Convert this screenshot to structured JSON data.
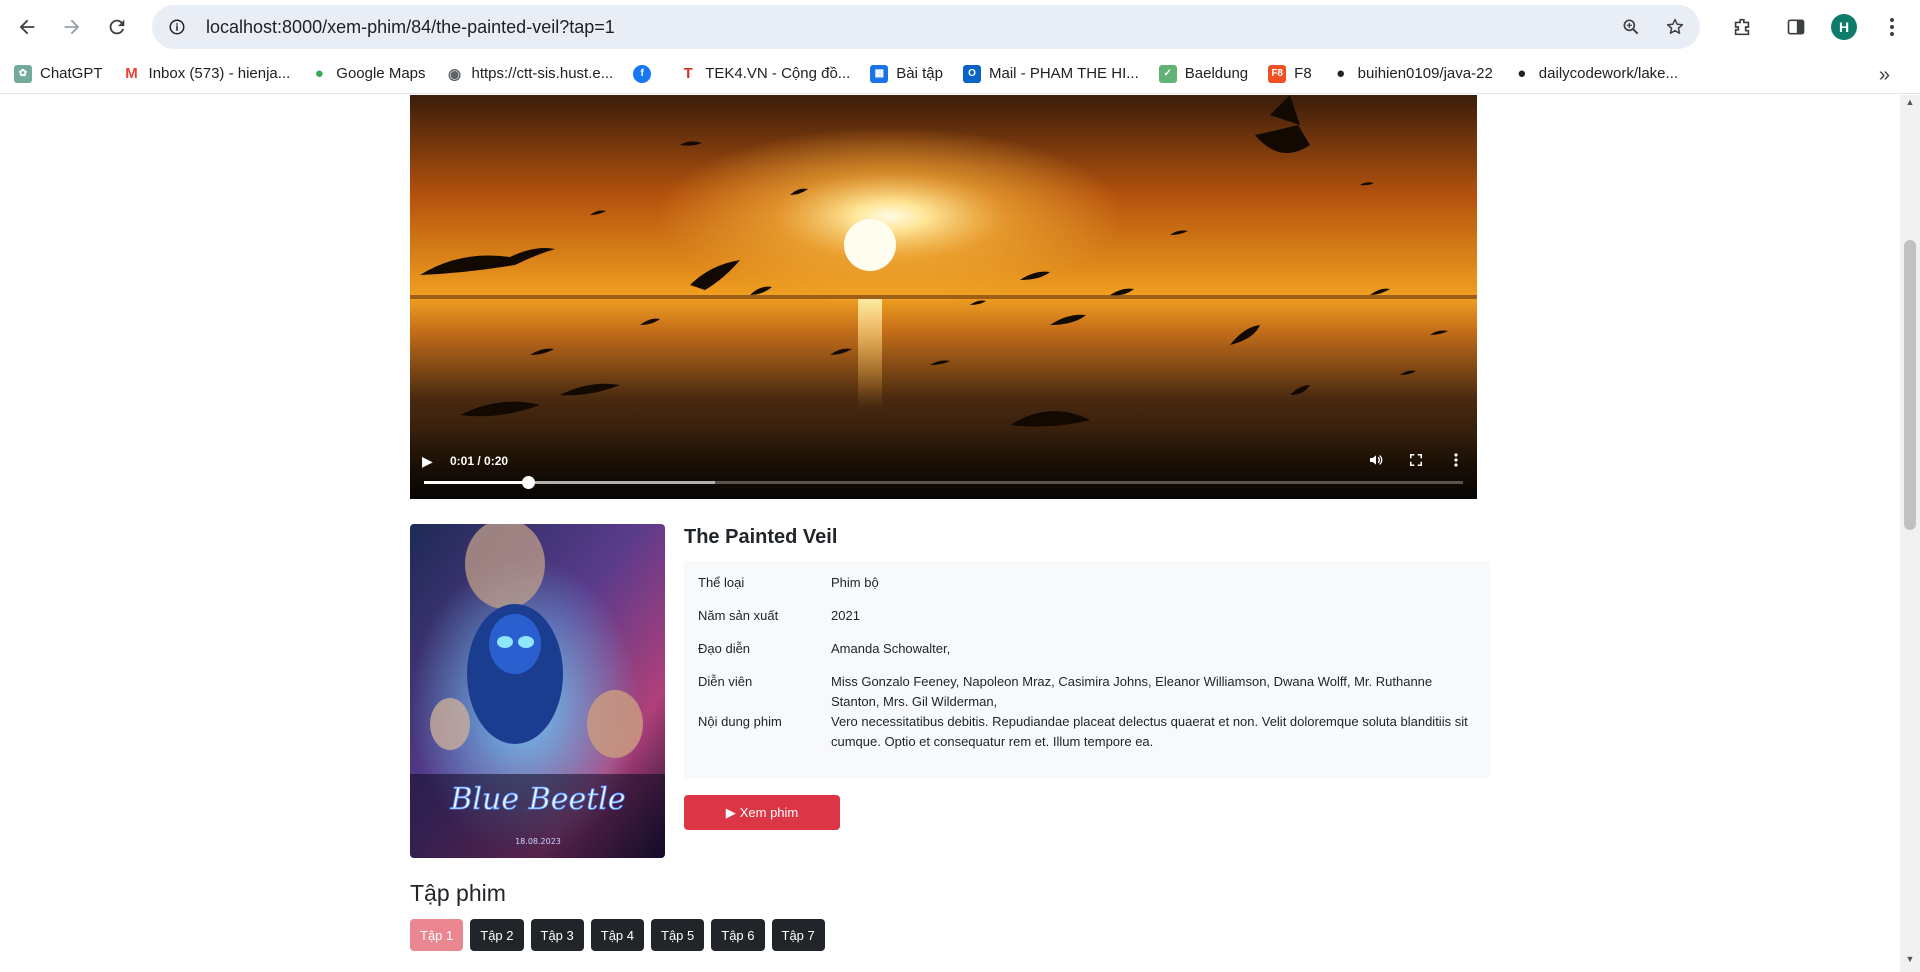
{
  "browser": {
    "url": "localhost:8000/xem-phim/84/the-painted-veil?tap=1",
    "profile_initial": "H",
    "bookmarks": [
      {
        "label": "ChatGPT",
        "icon": "chatgpt-icon",
        "color": "#74aa9c"
      },
      {
        "label": "Inbox (573) - hienja...",
        "icon": "gmail-icon",
        "color": "#ea4335"
      },
      {
        "label": "Google Maps",
        "icon": "maps-icon",
        "color": "#34a853"
      },
      {
        "label": "https://ctt-sis.hust.e...",
        "icon": "globe-icon",
        "color": "#5f6368"
      },
      {
        "label": "",
        "icon": "facebook-icon",
        "color": "#1877f2"
      },
      {
        "label": "TEK4.VN - Cộng đồ...",
        "icon": "tek4-icon",
        "color": "#d93025"
      },
      {
        "label": "Bài tập",
        "icon": "bai-tap-icon",
        "color": "#1a73e8"
      },
      {
        "label": "Mail - PHAM THE HI...",
        "icon": "outlook-icon",
        "color": "#0a64c8"
      },
      {
        "label": "Baeldung",
        "icon": "baeldung-icon",
        "color": "#63b175"
      },
      {
        "label": "F8",
        "icon": "f8-icon",
        "color": "#f05123"
      },
      {
        "label": "buihien0109/java-22",
        "icon": "github-icon",
        "color": "#202124"
      },
      {
        "label": "dailycodework/lake...",
        "icon": "github-icon",
        "color": "#202124"
      }
    ]
  },
  "video": {
    "time": "0:01 / 0:20",
    "progress": 0.1,
    "buffered": 0.28
  },
  "movie": {
    "title": "The Painted Veil",
    "poster_text": "Blue Beetle",
    "poster_date": "18.08.2023",
    "details": [
      {
        "key": "Thể loại",
        "value": "Phim bộ"
      },
      {
        "key": "Năm sản xuất",
        "value": "2021"
      },
      {
        "key": "Đạo diễn",
        "value": "Amanda Schowalter,"
      },
      {
        "key": "Diễn viên",
        "value": "Miss Gonzalo Feeney, Napoleon Mraz, Casimira Johns, Eleanor Williamson, Dwana Wolff, Mr. Ruthanne Stanton, Mrs. Gil Wilderman,"
      },
      {
        "key": "Nội dung phim",
        "value": "Vero necessitatibus debitis. Repudiandae placeat delectus quaerat et non. Velit doloremque soluta blanditiis sit cumque. Optio et consequatur rem et. Illum tempore ea."
      }
    ],
    "watch_label": "Xem phim"
  },
  "episodes": {
    "heading": "Tập phim",
    "items": [
      "Tập 1",
      "Tập 2",
      "Tập 3",
      "Tập 4",
      "Tập 5",
      "Tập 6",
      "Tập 7"
    ],
    "active_index": 0
  },
  "colors": {
    "accent_red": "#dc3545",
    "episode_active": "#ea868f",
    "episode_default": "#212529"
  }
}
